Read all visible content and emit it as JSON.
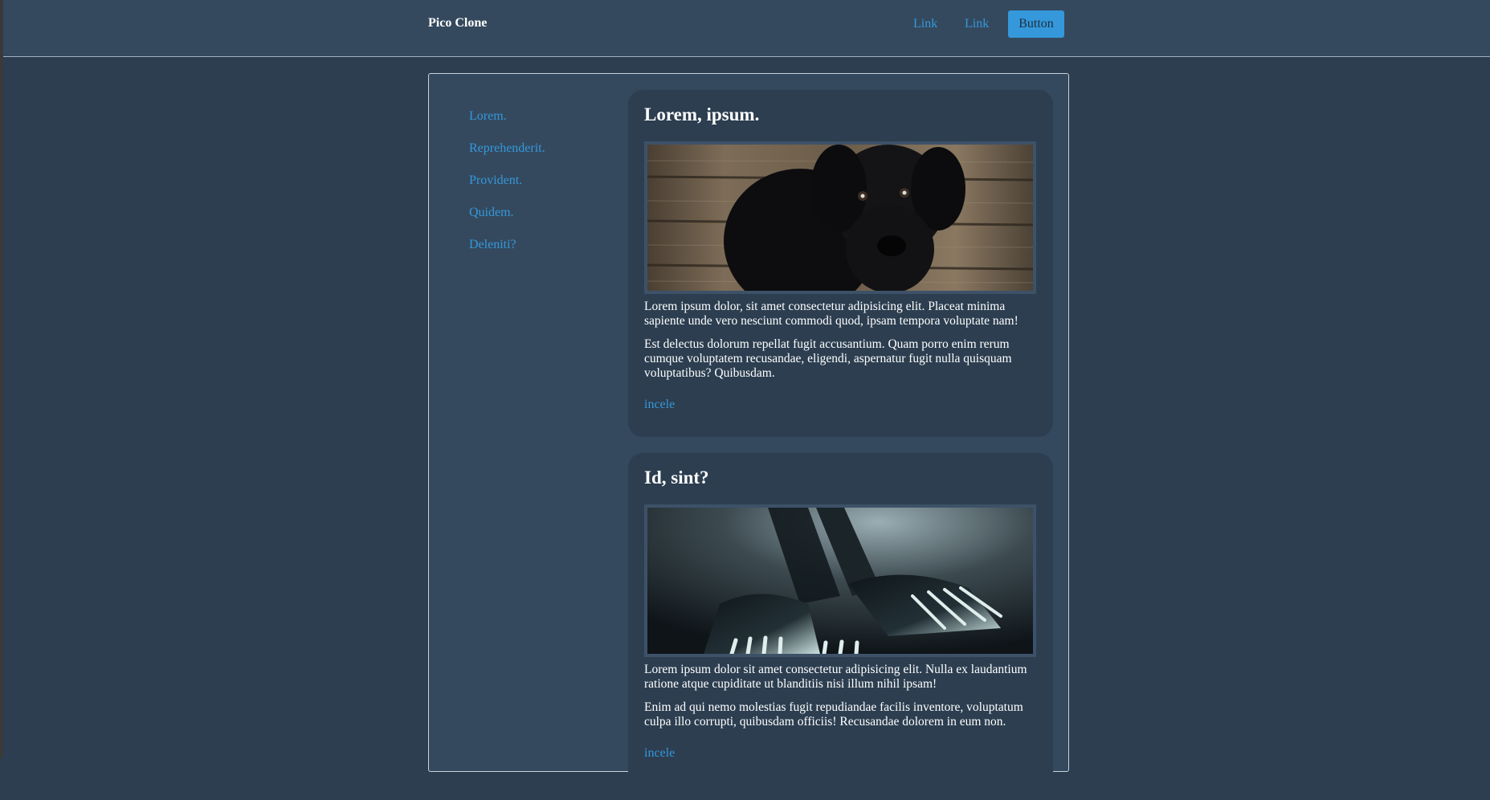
{
  "header": {
    "brand": "Pico Clone",
    "links": [
      "Link",
      "Link"
    ],
    "button_label": "Button"
  },
  "sidebar": {
    "items": [
      "Lorem.",
      "Reprehenderit.",
      "Provident.",
      "Quidem.",
      "Deleniti?"
    ]
  },
  "cards": [
    {
      "title": "Lorem, ipsum.",
      "image": "black-puppy-photo",
      "paragraphs": [
        "Lorem ipsum dolor, sit amet consectetur adipisicing elit. Placeat minima sapiente unde vero nesciunt commodi quod, ipsam tempora voluptate nam!",
        "Est delectus dolorum repellat fugit accusantium. Quam porro enim rerum cumque voluptatem recusandae, eligendi, aspernatur fugit nulla quisquam voluptatibus? Quibusdam."
      ],
      "link": "incele"
    },
    {
      "title": "Id, sint?",
      "image": "forks-photo",
      "paragraphs": [
        "Lorem ipsum dolor sit amet consectetur adipisicing elit. Nulla ex laudantium ratione atque cupiditate ut blanditiis nisi illum nihil ipsam!",
        "Enim ad qui nemo molestias fugit repudiandae facilis inventore, voluptatum culpa illo corrupti, quibusdam officiis! Recusandae dolorem in eum non."
      ],
      "link": "incele"
    }
  ],
  "colors": {
    "background": "#2d3e50",
    "surface": "#34495e",
    "card": "#2c3e50",
    "accent": "#3498db"
  }
}
